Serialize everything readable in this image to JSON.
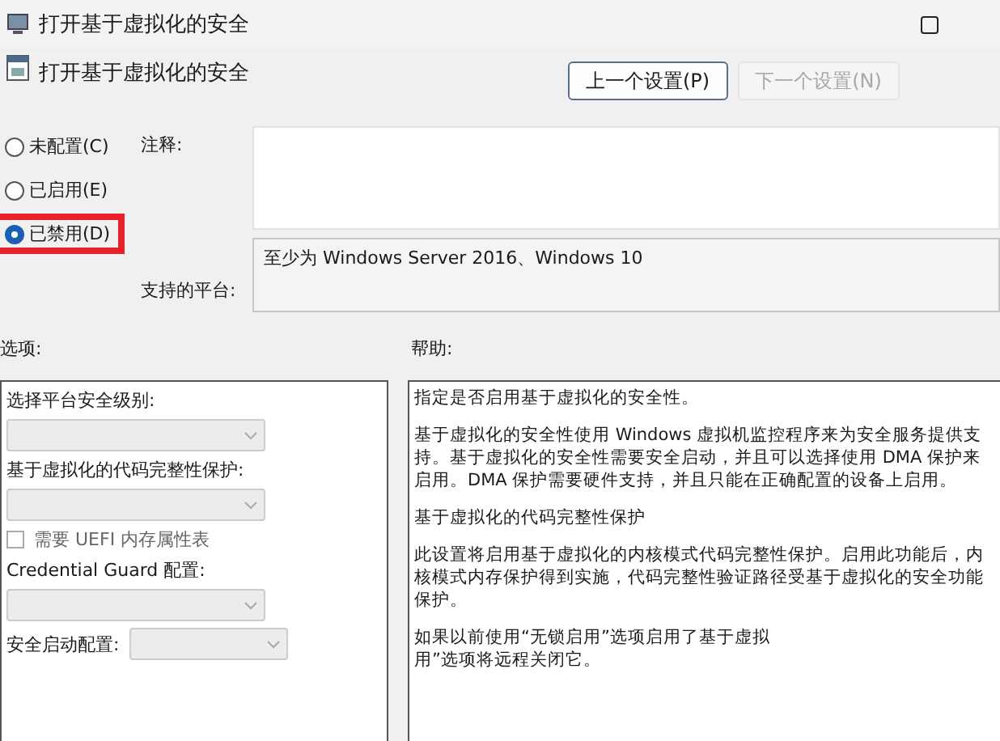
{
  "window": {
    "title": "打开基于虚拟化的安全"
  },
  "header": {
    "title": "打开基于虚拟化的安全",
    "buttons": [
      {
        "label": "上一个设置(P)",
        "disabled": false
      },
      {
        "label": "下一个设置(N)",
        "disabled": true
      }
    ]
  },
  "state_options": [
    {
      "label": "未配置(C)",
      "selected": false,
      "highlighted": false
    },
    {
      "label": "已启用(E)",
      "selected": false,
      "highlighted": false
    },
    {
      "label": "已禁用(D)",
      "selected": true,
      "highlighted": true
    }
  ],
  "comment": {
    "label": "注释:"
  },
  "platform": {
    "label": "支持的平台:",
    "value": "至少为 Windows Server 2016、Windows 10"
  },
  "options": {
    "label": "选项:",
    "items": [
      {
        "kind": "label",
        "text": "选择平台安全级别:"
      },
      {
        "kind": "dropdown",
        "disabled": true
      },
      {
        "kind": "label",
        "text": "基于虚拟化的代码完整性保护:"
      },
      {
        "kind": "dropdown",
        "disabled": true
      },
      {
        "kind": "checkbox",
        "text": "需要 UEFI 内存属性表",
        "checked": false
      },
      {
        "kind": "label",
        "text": "Credential Guard 配置:"
      },
      {
        "kind": "dropdown",
        "disabled": true
      },
      {
        "kind": "inline-dropdown",
        "text": "安全启动配置:",
        "disabled": true
      }
    ]
  },
  "help": {
    "label": "帮助:",
    "paragraphs": [
      "指定是否启用基于虚拟化的安全性。",
      "基于虚拟化的安全性使用 Windows 虚拟机监控程序来为安全服务提供支持。基于虚拟化的安全性需要安全启动，并且可以选择使用 DMA 保护来启用。DMA 保护需要硬件支持，并且只能在正确配置的设备上启用。",
      "基于虚拟化的代码完整性保护",
      "此设置将启用基于虚拟化的内核模式代码完整性保护。启用此功能后，内核模式内存保护得到实施，代码完整性验证路径受基于虚拟化的安全功能保护。"
    ],
    "partial_lines": [
      "如果以前使用“无锁启用”选项启用了基于虚拟",
      "用”选项将远程关闭它。"
    ]
  }
}
